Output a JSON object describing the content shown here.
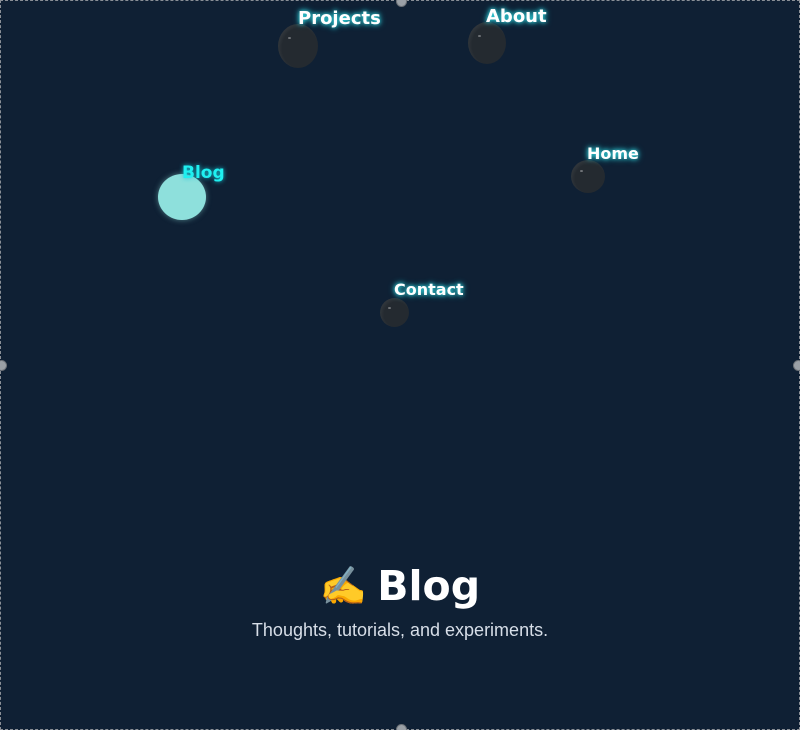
{
  "nav": {
    "items": [
      {
        "id": "projects",
        "label": "Projects",
        "active": false
      },
      {
        "id": "about",
        "label": "About",
        "active": false
      },
      {
        "id": "blog",
        "label": "Blog",
        "active": true
      },
      {
        "id": "home",
        "label": "Home",
        "active": false
      },
      {
        "id": "contact",
        "label": "Contact",
        "active": false
      }
    ]
  },
  "hero": {
    "icon": "writing-hand-icon",
    "icon_glyph": "✍️",
    "title": "Blog",
    "subtitle": "Thoughts, tutorials, and experiments."
  },
  "colors": {
    "background": "#0f2034",
    "bubble": "#242a30",
    "bubble_active": "#8ee0dc",
    "label_glow": "#37d9e0",
    "label_active": "#1ff0f0"
  }
}
